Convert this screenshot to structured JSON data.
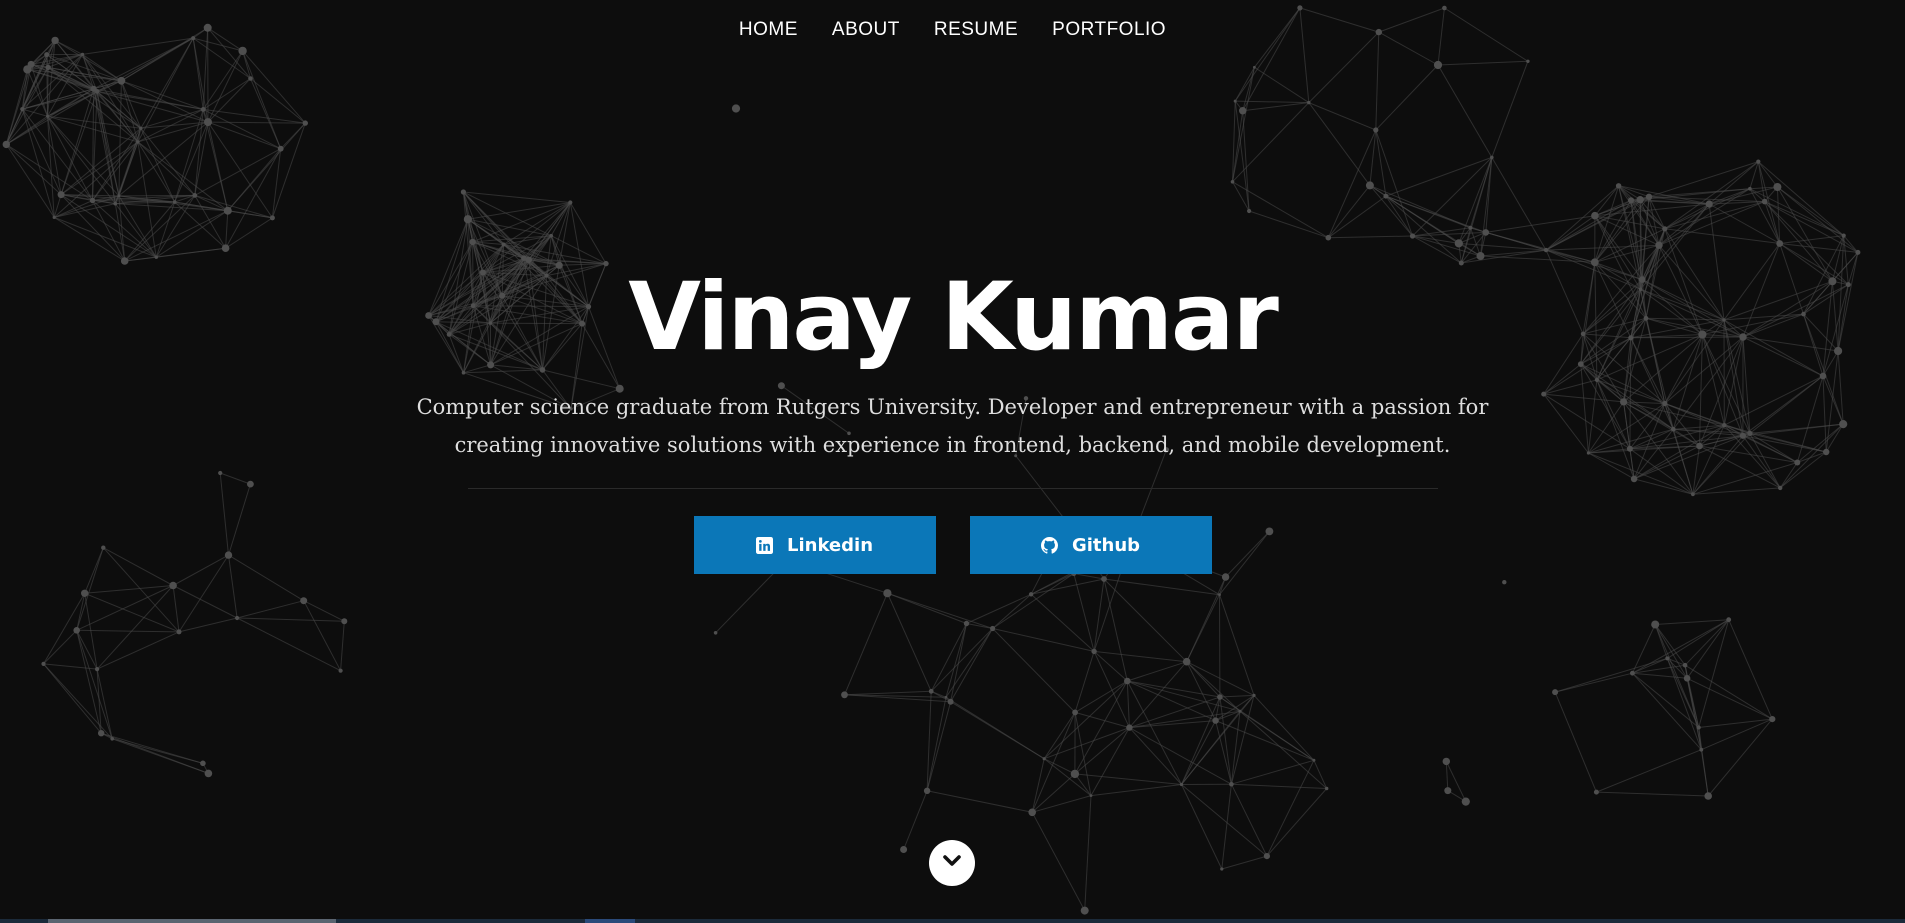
{
  "nav": {
    "items": [
      {
        "label": "HOME"
      },
      {
        "label": "ABOUT"
      },
      {
        "label": "RESUME"
      },
      {
        "label": "PORTFOLIO"
      }
    ]
  },
  "hero": {
    "name": "Vinay Kumar",
    "description": "Computer science graduate from Rutgers University. Developer and entrepreneur with a passion for creating innovative solutions with experience in frontend, backend, and mobile development."
  },
  "buttons": {
    "linkedin_label": "Linkedin",
    "github_label": "Github"
  },
  "icons": {
    "linkedin": "linkedin-icon",
    "github": "github-icon",
    "scroll": "chevron-down-icon"
  },
  "colors": {
    "background": "#0d0d0d",
    "button": "#0b77b8",
    "network": "#4a4a4a",
    "text": "#ffffff"
  }
}
